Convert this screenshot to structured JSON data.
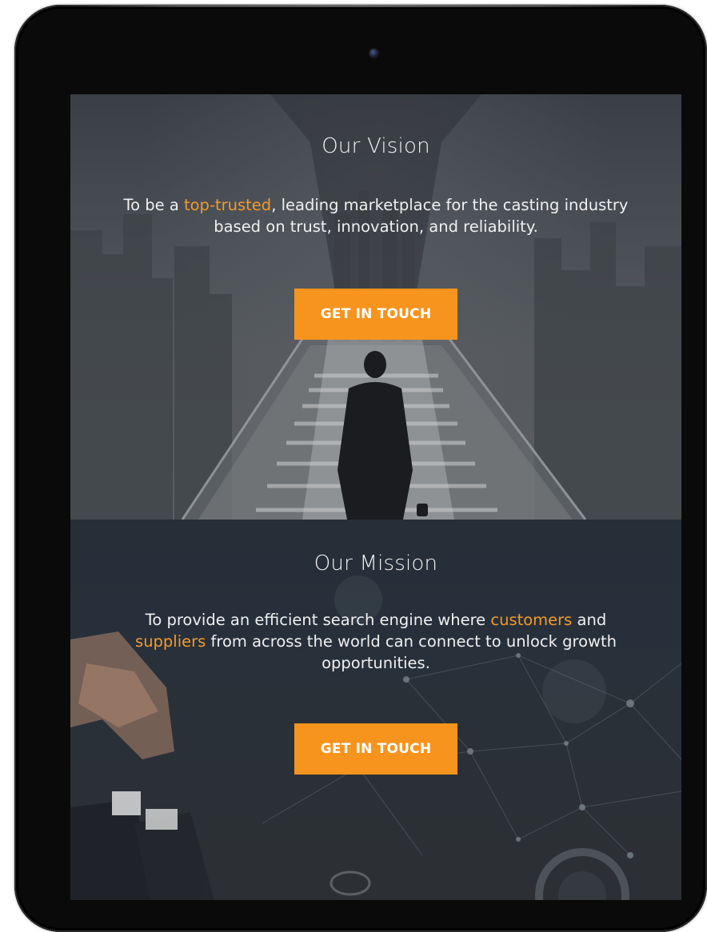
{
  "vision": {
    "title": "Our Vision",
    "text_before": "To be a ",
    "text_highlight": "top-trusted",
    "text_after": ", leading marketplace for the casting industry based on trust, innovation, and reliability.",
    "cta_label": "GET IN TOUCH"
  },
  "mission": {
    "title": "Our Mission",
    "text_before": "To provide an efficient search engine where ",
    "text_highlight_1": "customers",
    "text_middle": " and ",
    "text_highlight_2": "suppliers",
    "text_after": " from across the world can connect to unlock growth opportunities.",
    "cta_label": "GET IN TOUCH"
  },
  "colors": {
    "accent": "#f7941e",
    "highlight_text": "#f39a2b",
    "device_frame": "#0a0a0a"
  }
}
